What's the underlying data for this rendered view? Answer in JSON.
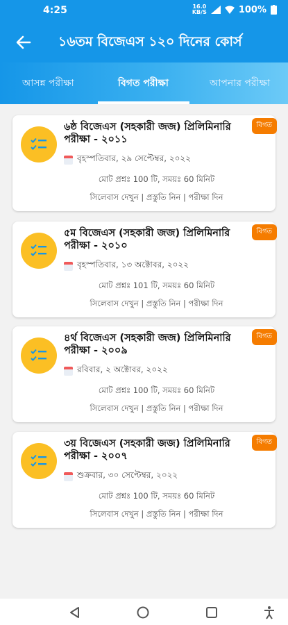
{
  "status": {
    "time": "4:25",
    "net_top": "16.0",
    "net_bottom": "KB/S",
    "battery": "100%"
  },
  "header": {
    "title": "১৬তম বিজেএস ১২০ দিনের কোর্স"
  },
  "tabs": [
    {
      "label": "আসন্ন পরীক্ষা"
    },
    {
      "label": "বিগত পরীক্ষা"
    },
    {
      "label": "আপনার পরীক্ষা"
    }
  ],
  "cards": [
    {
      "badge": "বিগত",
      "title": "৬ষ্ঠ বিজেএস (সহকারী জজ) প্রিলিমিনারি পরীক্ষা - ২০১১",
      "date": "বৃহস্পতিবার, ২৯ সেপ্টেম্বর, ২০২২",
      "meta": "মোট প্রশ্নঃ 100 টি, সময়ঃ 60 মিনিট",
      "links": "সিলেবাস দেখুন | প্রস্তুতি নিন | পরীক্ষা দিন"
    },
    {
      "badge": "বিগত",
      "title": "৫ম বিজেএস (সহকারী জজ) প্রিলিমিনারি পরীক্ষা - ২০১০",
      "date": "বৃহস্পতিবার, ১৩ অক্টোবর, ২০২২",
      "meta": "মোট প্রশ্নঃ 101 টি, সময়ঃ 60 মিনিট",
      "links": "সিলেবাস দেখুন | প্রস্তুতি নিন | পরীক্ষা দিন"
    },
    {
      "badge": "বিগত",
      "title": "৪র্থ বিজেএস (সহকারী জজ) প্রিলিমিনারি পরীক্ষা - ২০০৯",
      "date": "রবিবার, ২ অক্টোবর, ২০২২",
      "meta": "মোট প্রশ্নঃ 100 টি, সময়ঃ 60 মিনিট",
      "links": "সিলেবাস দেখুন | প্রস্তুতি নিন | পরীক্ষা দিন"
    },
    {
      "badge": "বিগত",
      "title": "৩য় বিজেএস (সহকারী জজ) প্রিলিমিনারি পরীক্ষা - ২০০৭",
      "date": "শুক্রবার, ৩০ সেপ্টেম্বর, ২০২২",
      "meta": "মোট প্রশ্নঃ 100 টি, সময়ঃ 60 মিনিট",
      "links": "সিলেবাস দেখুন | প্রস্তুতি নিন | পরীক্ষা দিন"
    }
  ],
  "icons": {
    "list": "checklist-icon",
    "calendar": "calendar-icon"
  },
  "colors": {
    "primary": "#1596e8",
    "badge": "#f57c00",
    "icon_bg": "#fbbf24"
  }
}
